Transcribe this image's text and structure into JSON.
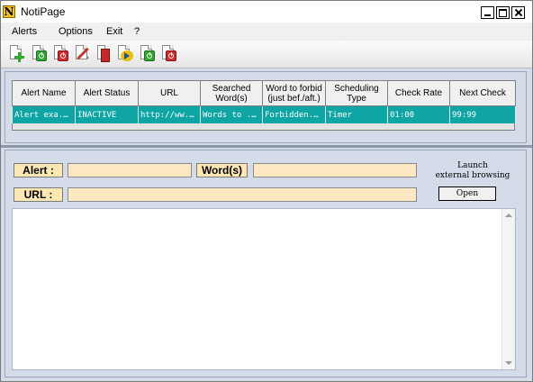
{
  "app": {
    "title": "NotiPage",
    "icon_letter": "N"
  },
  "menu": {
    "items": [
      "Alerts",
      "Options",
      "Exit",
      "?"
    ]
  },
  "toolbar": {
    "icons": [
      "new-alert-icon",
      "start-icon",
      "stop-icon",
      "settings-tools-icon",
      "delete-icon",
      "forward-icon",
      "start-all-icon",
      "stop-all-icon"
    ]
  },
  "table": {
    "columns": [
      "Alert Name",
      "Alert Status",
      "URL",
      "Searched Word(s)",
      "Word to forbid (just bef./aft.)",
      "Scheduling Type",
      "Check Rate",
      "Next Check"
    ],
    "rows": [
      [
        "Alert exa...",
        "INACTIVE",
        "http://ww...",
        "Words to ...",
        "Forbidden...",
        "Timer",
        "01:00",
        "99:99"
      ]
    ]
  },
  "form": {
    "alert_label": "Alert :",
    "words_label": "Word(s)",
    "url_label": "URL :",
    "alert_value": "",
    "words_value": "",
    "url_value": "",
    "launch_line1": "Launch",
    "launch_line2": "external browsing",
    "open_button": "Open"
  },
  "colors": {
    "selected_row": "#10a5a5",
    "panel_background": "#d4dcea",
    "field_background": "#fde8c4"
  }
}
